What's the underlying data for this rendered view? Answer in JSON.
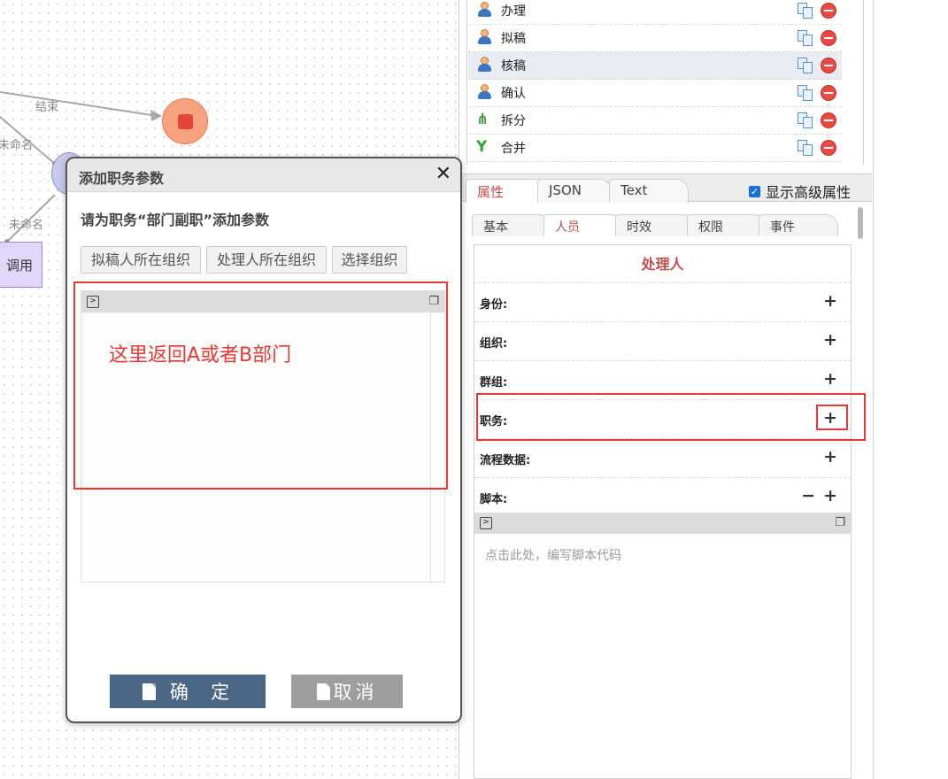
{
  "canvas": {
    "labels": {
      "end": "结束",
      "unnamed_1": "未命名",
      "unnamed_2": "未命名"
    },
    "call_node": "调用",
    "colors": {
      "end_node": "#f8a37f",
      "stop": "#e5443a",
      "call_node": "#e2d7fb"
    }
  },
  "dialog": {
    "title": "添加职务参数",
    "close_icon": "close-icon",
    "prompt": "请为职务“部门副职”添加参数",
    "org_buttons": [
      "拟稿人所在组织",
      "处理人所在组织",
      "选择组织"
    ],
    "annotation": "这里返回A或者B部门",
    "confirm_label": "确  定",
    "cancel_label": "取消",
    "colors": {
      "confirm": "#4a6784",
      "cancel": "#9e9e9e",
      "highlight": "#e53935"
    }
  },
  "tools": [
    {
      "name": "办理",
      "icon": "user-icon"
    },
    {
      "name": "拟稿",
      "icon": "user-icon"
    },
    {
      "name": "核稿",
      "icon": "user-icon",
      "selected": true
    },
    {
      "name": "确认",
      "icon": "user-icon"
    },
    {
      "name": "拆分",
      "icon": "split-icon"
    },
    {
      "name": "合并",
      "icon": "merge-icon"
    }
  ],
  "tabs": {
    "main": [
      "属性",
      "JSON",
      "Text"
    ],
    "active_main": "属性",
    "show_advanced": "显示高级属性",
    "sub": [
      "基本",
      "人员",
      "时效",
      "权限",
      "事件"
    ],
    "active_sub": "人员"
  },
  "props": {
    "title": "处理人",
    "rows": [
      "身份:",
      "组织:",
      "群组:",
      "职务:",
      "流程数据:",
      "脚本:"
    ],
    "script_placeholder": "点击此处，编写脚本代码"
  }
}
